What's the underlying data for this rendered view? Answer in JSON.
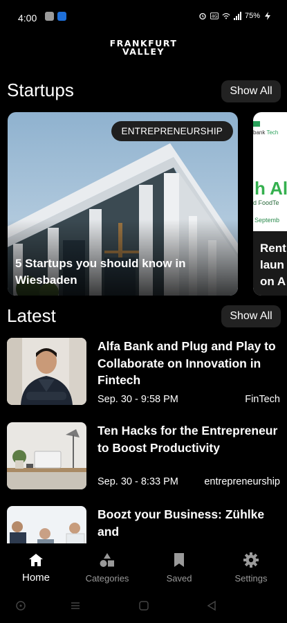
{
  "status_bar": {
    "time": "4:00",
    "battery": "75%"
  },
  "logo": {
    "line1": "FRANKFURT",
    "line2": "VALLEY"
  },
  "startups": {
    "title": "Startups",
    "show_all": "Show All",
    "cards": [
      {
        "badge": "ENTREPRENEURSHIP",
        "title": "5 Startups you should know in Wiesbaden"
      },
      {
        "peek_top_a": "bank",
        "peek_top_b": "Tech",
        "peek_heading": "h All",
        "peek_sub1": "d FoodTe",
        "peek_sub2": "Septemb",
        "peek_line1": "Rent",
        "peek_line2": "laun",
        "peek_line3": "on A"
      }
    ]
  },
  "latest": {
    "title": "Latest",
    "show_all": "Show All",
    "items": [
      {
        "title": "Alfa Bank and Plug and Play to Collaborate on Innovation in Fintech",
        "date": "Sep. 30 - 9:58 PM",
        "category": "FinTech"
      },
      {
        "title": "Ten Hacks for the Entrepreneur to Boost Productivity",
        "date": "Sep. 30 - 8:33 PM",
        "category": "entrepreneurship"
      },
      {
        "title": "Boozt your Business: Zühlke and",
        "date": "",
        "category": ""
      }
    ]
  },
  "bottom_nav": {
    "items": [
      {
        "label": "Home",
        "icon": "home-icon"
      },
      {
        "label": "Categories",
        "icon": "categories-icon"
      },
      {
        "label": "Saved",
        "icon": "bookmark-icon"
      },
      {
        "label": "Settings",
        "icon": "gear-icon"
      }
    ]
  },
  "colors": {
    "background": "#000000",
    "button_bg": "#222222",
    "accent_green": "#35b04f"
  }
}
